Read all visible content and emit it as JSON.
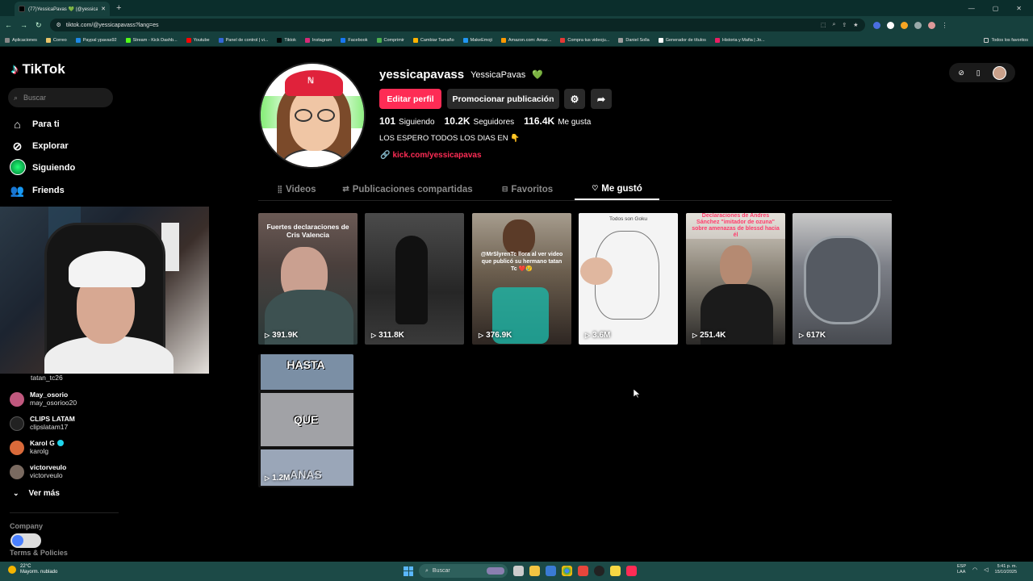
{
  "browser": {
    "tab_title": "(77)YessicaPavas 💚 (@yessica...",
    "url": "tiktok.com/@yessicapavass?lang=es",
    "bookmarks": [
      "Aplicaciones",
      "Correo",
      "Paypal ypavas92",
      "Stream - Kick Dashb...",
      "Youtube",
      "Panel de control | vi...",
      "Tiktok",
      "Instagram",
      "Facebook",
      "Comprimir",
      "Cambiar Tamaño",
      "MakeEmoji",
      "Amazon.com: Amaz...",
      "Compra tus videoju...",
      "Daniel Solla",
      "Generador de títulos",
      "Historia y Mafia | Jo..."
    ],
    "bookmarks_all": "Todos los favoritos",
    "bookmark_colors": [
      "#888888",
      "#e9c46a",
      "#1e88e5",
      "#53fc18",
      "#ff0000",
      "#3367d6",
      "#000000",
      "#d62976",
      "#1877f2",
      "#4caf50",
      "#ffb300",
      "#2196f3",
      "#ff9900",
      "#e53935",
      "#9e9e9e",
      "#ffffff",
      "#e91e63"
    ]
  },
  "sidebar": {
    "logo_text": "TikTok",
    "search_placeholder": "Buscar",
    "nav": [
      {
        "label": "Para ti",
        "icon": "home-icon"
      },
      {
        "label": "Explorar",
        "icon": "compass-icon"
      },
      {
        "label": "Siguiendo",
        "icon": "following-avatar"
      },
      {
        "label": "Friends",
        "icon": "friends-icon"
      }
    ],
    "following": [
      {
        "name": "",
        "handle": "tatan_tc26",
        "color": "#444"
      },
      {
        "name": "May_osorio",
        "handle": "may_osorioo20",
        "color": "#c0587e"
      },
      {
        "name": "CLIPS LATAM",
        "handle": "clipslatam17",
        "color": "#222"
      },
      {
        "name": "Karol G",
        "handle": "karolg",
        "color": "#d96a3a",
        "verified": true
      },
      {
        "name": "victorveulo",
        "handle": "victorveulo",
        "color": "#7a6a60"
      }
    ],
    "see_more": "Ver más",
    "company": "Company",
    "terms": "Terms & Policies"
  },
  "profile": {
    "username": "yessicapavass",
    "display_name": "YessicaPavas",
    "name_emoji": "💚",
    "edit_button": "Editar perfil",
    "promote_button": "Promocionar publicación",
    "following_count": "101",
    "following_label": "Siguiendo",
    "followers_count": "10.2K",
    "followers_label": "Seguidores",
    "likes_count": "116.4K",
    "likes_label": "Me gusta",
    "bio": "LOS ESPERO TODOS LOS DIAS EN 👇",
    "link": "kick.com/yessicapavas"
  },
  "tabs": [
    {
      "label": "Videos",
      "icon": "grid-icon",
      "active": false
    },
    {
      "label": "Publicaciones compartidas",
      "icon": "repost-icon",
      "active": false
    },
    {
      "label": "Favoritos",
      "icon": "bookmark-icon",
      "active": false
    },
    {
      "label": "Me gustó",
      "icon": "heart-outline-icon",
      "active": true
    }
  ],
  "videos": [
    {
      "views": "391.9K",
      "caption": "Fuertes declaraciones de Cris Valencia",
      "caption_color": "#ffffff"
    },
    {
      "views": "311.8K",
      "caption": "",
      "caption_color": "#ffffff"
    },
    {
      "views": "376.9K",
      "caption": "@MrSlyrenTc llora al ver video que publicó su hermano tatan Tc ❤️😢",
      "caption_color": "#ffffff"
    },
    {
      "views": "3.6M",
      "caption": "Todos son Goku",
      "caption_color": "#333333"
    },
    {
      "views": "251.4K",
      "caption": "Declaraciones de Andres Sánchez \"imitador de ozuna\" sobre amenazas de blessd hacia él",
      "caption_color": "#ff3b6b"
    },
    {
      "views": "617K",
      "caption": "",
      "caption_color": "#ffffff"
    },
    {
      "views": "1.2M",
      "caption_words": [
        "HASTA",
        "QUE",
        "ANAS"
      ]
    }
  ],
  "taskbar": {
    "weather_temp": "22°C",
    "weather_desc": "Mayorm. nublado",
    "search_label": "Buscar",
    "lang_top": "ESP",
    "lang_bottom": "LAA",
    "time": "5:41 p. m.",
    "date": "15/10/2025"
  }
}
